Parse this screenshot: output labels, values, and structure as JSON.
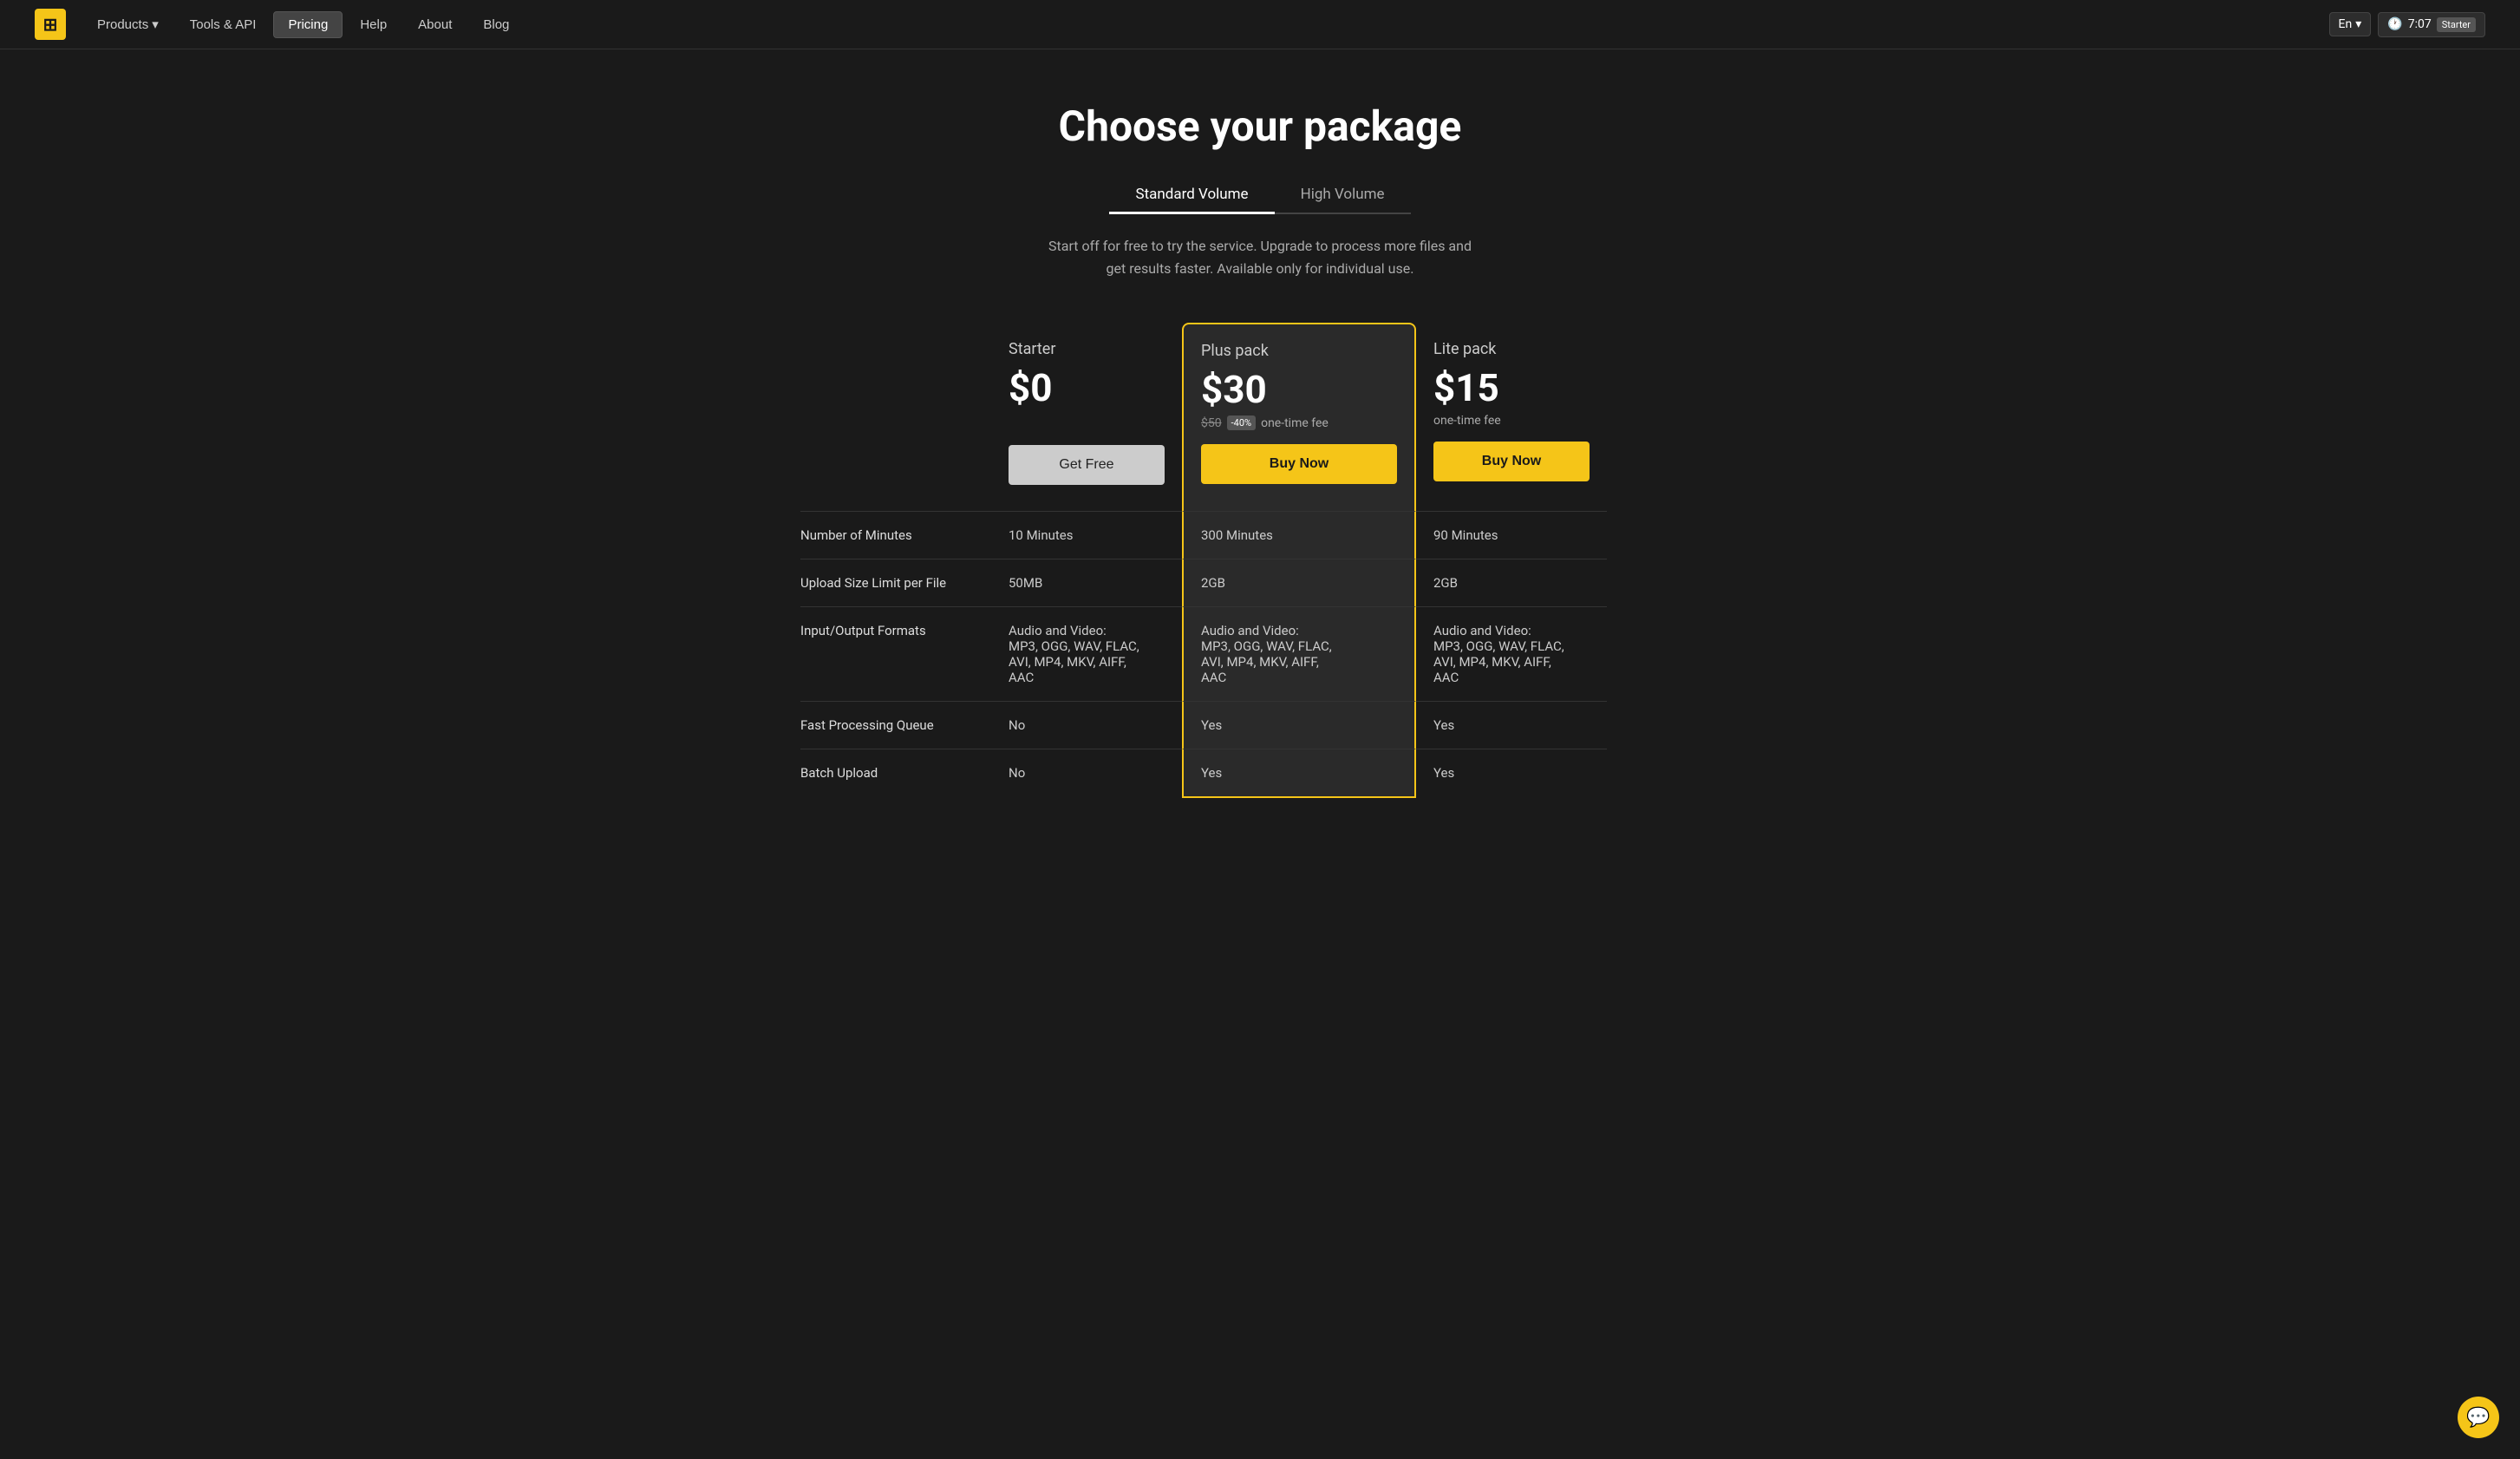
{
  "nav": {
    "logo_symbol": "⊞",
    "links": [
      {
        "label": "Products",
        "id": "products",
        "active": false,
        "has_dropdown": true
      },
      {
        "label": "Tools & API",
        "id": "tools-api",
        "active": false,
        "has_dropdown": false
      },
      {
        "label": "Pricing",
        "id": "pricing",
        "active": true,
        "has_dropdown": false
      },
      {
        "label": "Help",
        "id": "help",
        "active": false,
        "has_dropdown": false
      },
      {
        "label": "About",
        "id": "about",
        "active": false,
        "has_dropdown": false
      },
      {
        "label": "Blog",
        "id": "blog",
        "active": false,
        "has_dropdown": false
      }
    ],
    "lang": "En",
    "timer": "7:07",
    "user_plan": "Starter"
  },
  "page": {
    "title": "Choose your package",
    "subtitle": "Start off for free to try the service. Upgrade to process more files and\nget results faster. Available only for individual use."
  },
  "tabs": [
    {
      "label": "Standard Volume",
      "id": "standard",
      "active": true
    },
    {
      "label": "High Volume",
      "id": "high",
      "active": false
    }
  ],
  "plans": [
    {
      "id": "starter",
      "name": "Starter",
      "price": "$0",
      "price_detail": "",
      "cta": "Get Free",
      "highlighted": false
    },
    {
      "id": "plus",
      "name": "Plus pack",
      "price": "$30",
      "price_original": "$50",
      "discount": "-40%",
      "price_detail": "one-time fee",
      "cta": "Buy Now",
      "highlighted": true
    },
    {
      "id": "lite",
      "name": "Lite pack",
      "price": "$15",
      "price_detail": "one-time fee",
      "cta": "Buy Now",
      "highlighted": false
    }
  ],
  "features": [
    {
      "label": "Number of Minutes",
      "starter": "10 Minutes",
      "plus": "300 Minutes",
      "lite": "90 Minutes"
    },
    {
      "label": "Upload Size Limit per File",
      "starter": "50MB",
      "plus": "2GB",
      "lite": "2GB"
    },
    {
      "label": "Input/Output Formats",
      "starter": "Audio and Video:\nMP3, OGG, WAV, FLAC,\nAVI, MP4, MKV, AIFF,\nAAC",
      "plus": "Audio and Video:\nMP3, OGG, WAV, FLAC,\nAVI, MP4, MKV, AIFF,\nAAC",
      "lite": "Audio and Video:\nMP3, OGG, WAV, FLAC,\nAVI, MP4, MKV, AIFF,\nAAC"
    },
    {
      "label": "Fast Processing Queue",
      "starter": "No",
      "plus": "Yes",
      "lite": "Yes"
    },
    {
      "label": "Batch Upload",
      "starter": "No",
      "plus": "Yes",
      "lite": "Yes"
    }
  ],
  "chat_icon": "💬"
}
